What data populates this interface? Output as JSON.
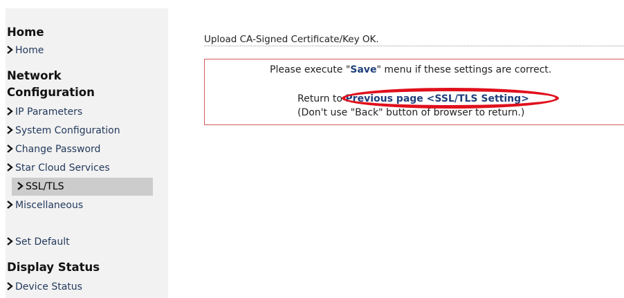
{
  "sidebar": {
    "home_title": "Home",
    "home_link": "Home",
    "network_title_line1": "Network",
    "network_title_line2": "Configuration",
    "items": [
      "IP Parameters",
      "System Configuration",
      "Change Password",
      "Star Cloud Services",
      "SSL/TLS",
      "Miscellaneous"
    ],
    "set_default": "Set Default",
    "display_title": "Display Status",
    "device_status": "Device Status",
    "active_item": "SSL/TLS"
  },
  "main": {
    "message": "Upload CA-Signed Certificate/Key OK.",
    "notice_prefix": "Please execute \"",
    "notice_save": "Save",
    "notice_suffix": "\" menu if these settings are correct.",
    "return_prefix": "Return to ",
    "return_link": "Previous page <SSL/TLS Setting>",
    "back_note": "(Don't use \"Back\" button of browser to return.)"
  },
  "colors": {
    "sidebar_bg": "#f2f2f2",
    "active_bg": "#cccccc",
    "link": "#1f3f7a",
    "box_border": "#d65a5a",
    "annotation": "#e0101c"
  }
}
